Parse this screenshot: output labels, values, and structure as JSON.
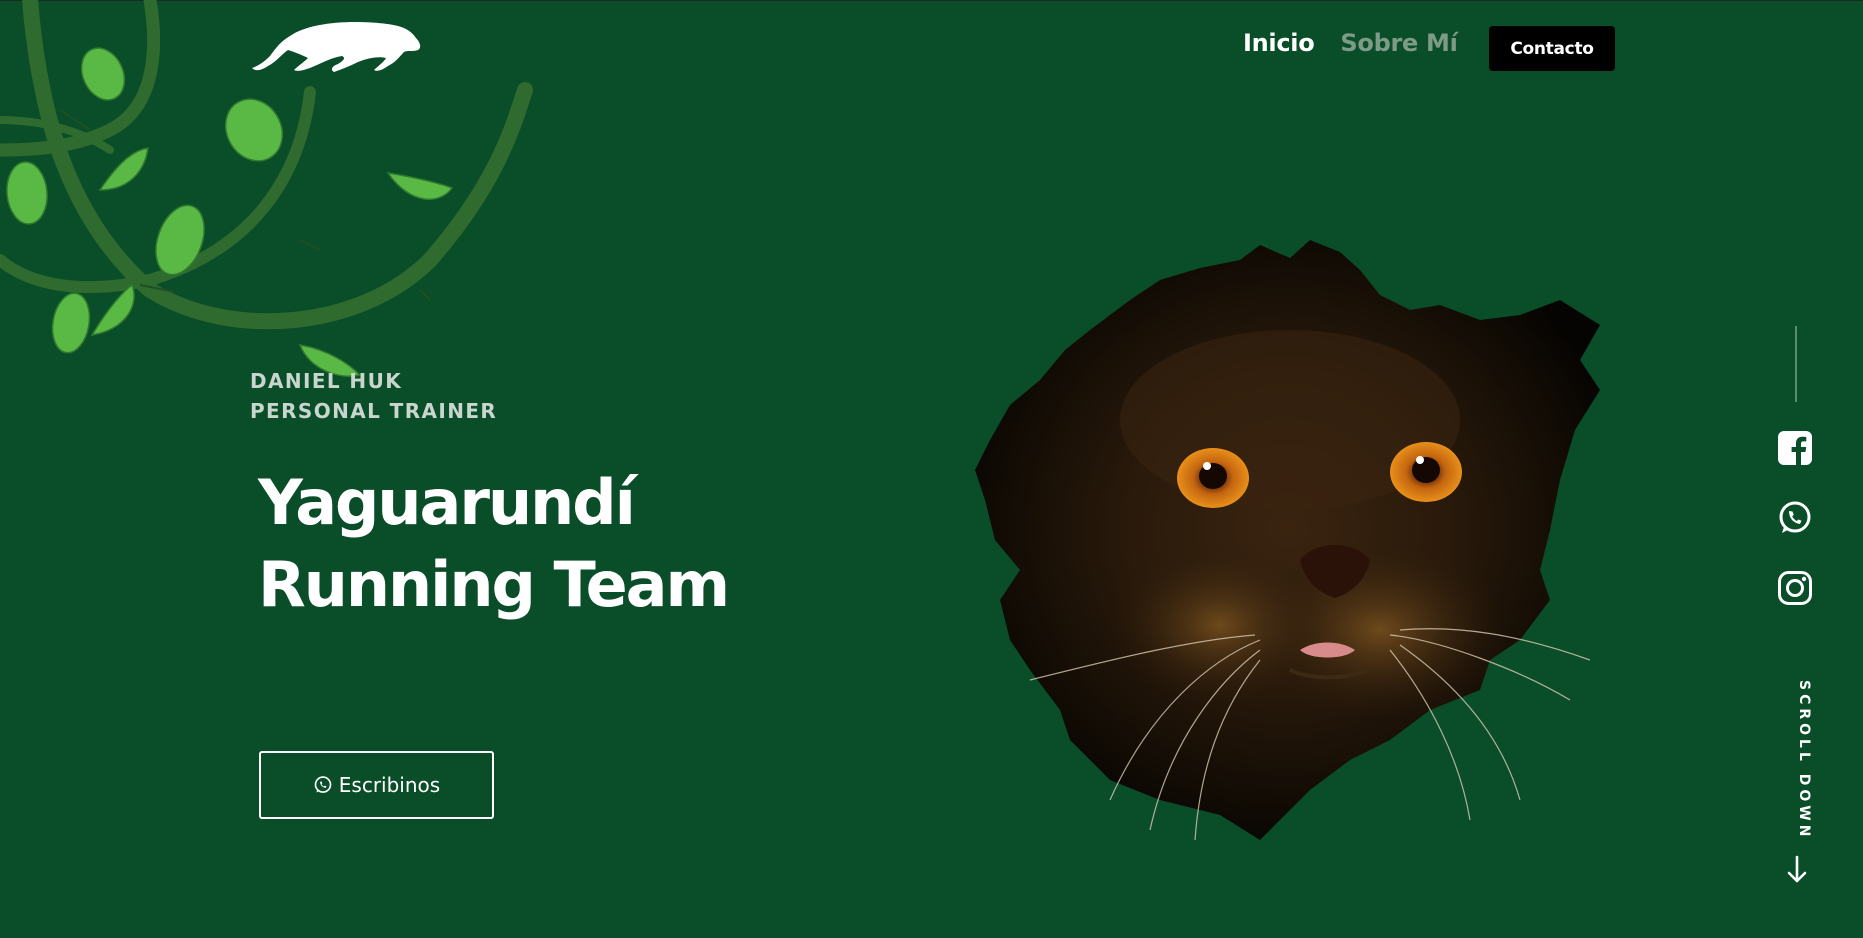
{
  "header": {
    "logo_icon": "jaguar-logo-icon",
    "nav": [
      {
        "label": "Inicio",
        "active": true
      },
      {
        "label": "Sobre Mí",
        "active": false
      }
    ],
    "contact_label": "Contacto"
  },
  "hero": {
    "subtitle_line1": "DANIEL HUK",
    "subtitle_line2": "PERSONAL TRAINER",
    "title_line1": "Yaguarundí",
    "title_line2": "Running Team",
    "cta_label": "Escribinos",
    "cta_icon": "whatsapp-icon",
    "image": "jaguar-face-image"
  },
  "social": {
    "icons": [
      "facebook-icon",
      "whatsapp-icon",
      "instagram-icon"
    ],
    "scroll_label": "SCROLL DOWN",
    "scroll_icon": "arrow-down-icon"
  },
  "colors": {
    "background": "#0a4d29",
    "nav_inactive": "#7e9b88",
    "contact_button": "#000000",
    "subtitle": "#c9d6cd",
    "vine": "#2f6b2f",
    "leaf": "#5ab844"
  }
}
